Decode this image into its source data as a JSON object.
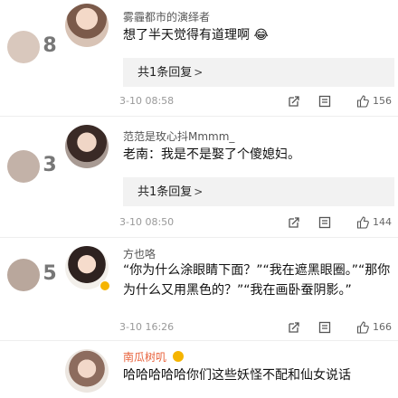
{
  "comments": [
    {
      "username": "雾霾都市的演绎者",
      "text": "想了半天觉得有道理啊",
      "emoji": "😂",
      "replies_label": "共1条回复",
      "date": "3-10 08:58",
      "likes": "156"
    },
    {
      "username": "范范是玫心抖Mmmm_",
      "text": "老南：我是不是娶了个傻媳妇。",
      "replies_label": "共1条回复",
      "date": "3-10 08:50",
      "likes": "144"
    },
    {
      "username": "方也咯",
      "text": "“你为什么涂眼睛下面？”“我在遮黑眼圈。”“那你为什么又用黑色的？”“我在画卧蚕阴影。”",
      "date": "3-10 16:26",
      "likes": "166"
    },
    {
      "username": "南瓜树叽",
      "text": "哈哈哈哈哈你们这些妖怪不配和仙女说话"
    }
  ],
  "side_numbers": [
    "8",
    "3",
    "5"
  ],
  "icons": {
    "share": "share-icon",
    "comment": "comment-icon",
    "like": "thumbs-up-icon"
  },
  "colors": {
    "username_gray": "#555555",
    "username_orange": "#e8623c",
    "reply_bg": "#f2f2f2"
  }
}
